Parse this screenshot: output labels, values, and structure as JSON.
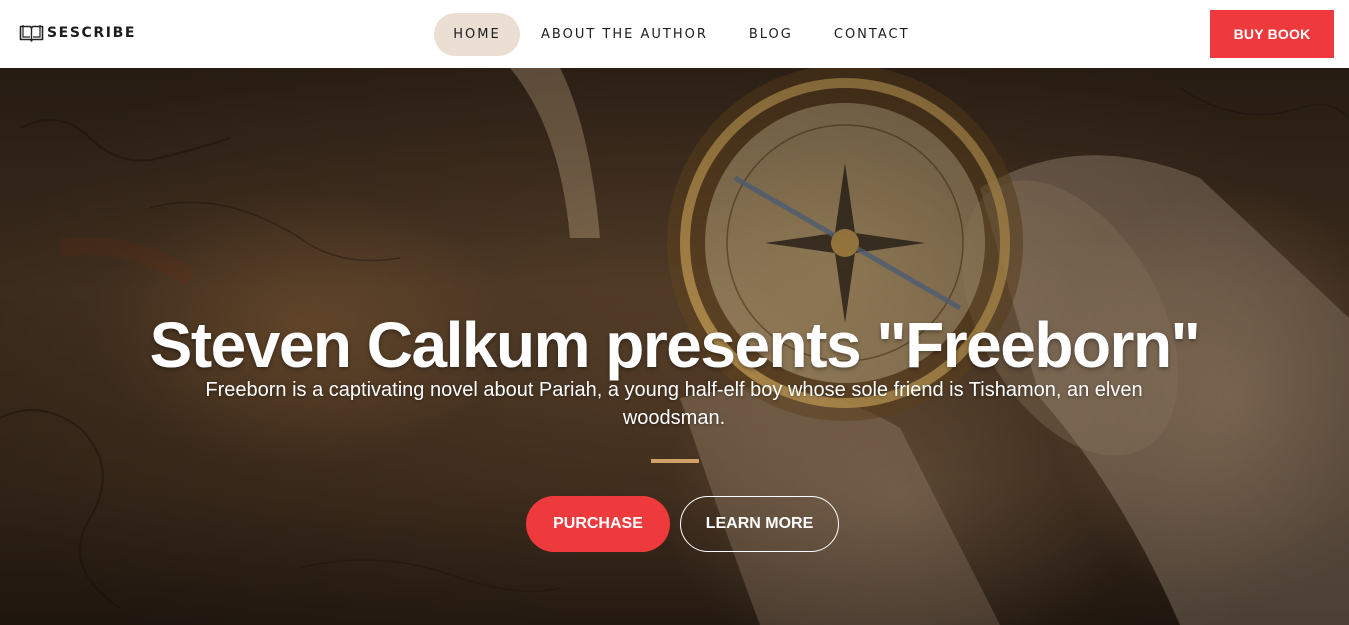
{
  "header": {
    "logo_icon": "open-book-icon",
    "logo_text": "SESCRIBE",
    "nav": [
      {
        "label": "HOME",
        "active": true
      },
      {
        "label": "ABOUT THE AUTHOR",
        "active": false
      },
      {
        "label": "BLOG",
        "active": false
      },
      {
        "label": "CONTACT",
        "active": false
      }
    ],
    "buy_label": "BUY BOOK"
  },
  "hero": {
    "title": "Steven Calkum presents \"Freeborn\"",
    "subtitle": "Freeborn is a captivating novel about Pariah, a young half-elf boy whose sole friend is Tishamon, an elven woodsman.",
    "purchase_label": "PURCHASE",
    "learn_more_label": "LEARN MORE",
    "background_image": "antique-map-with-compass-and-scrolls"
  },
  "colors": {
    "accent": "#ef3a3d",
    "active_nav_bg": "#eadfd2",
    "divider": "#d2a066"
  }
}
